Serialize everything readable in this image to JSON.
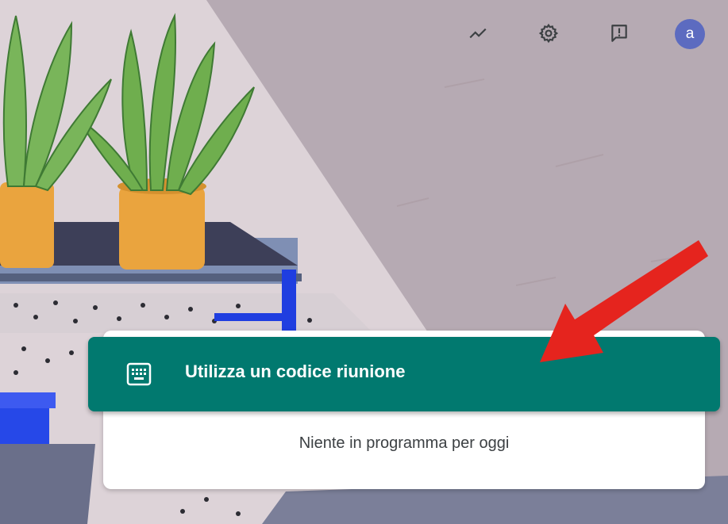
{
  "header": {
    "icons": [
      "trend-icon",
      "gear-icon",
      "feedback-icon"
    ],
    "avatar_letter": "a"
  },
  "actions": {
    "join_with_code_label": "Utilizza un codice riunione"
  },
  "schedule": {
    "empty_message": "Niente in programma per oggi"
  },
  "colors": {
    "accent_green": "#01796f",
    "avatar_bg": "#5c6bc0",
    "annotation_arrow": "#e5241e"
  }
}
